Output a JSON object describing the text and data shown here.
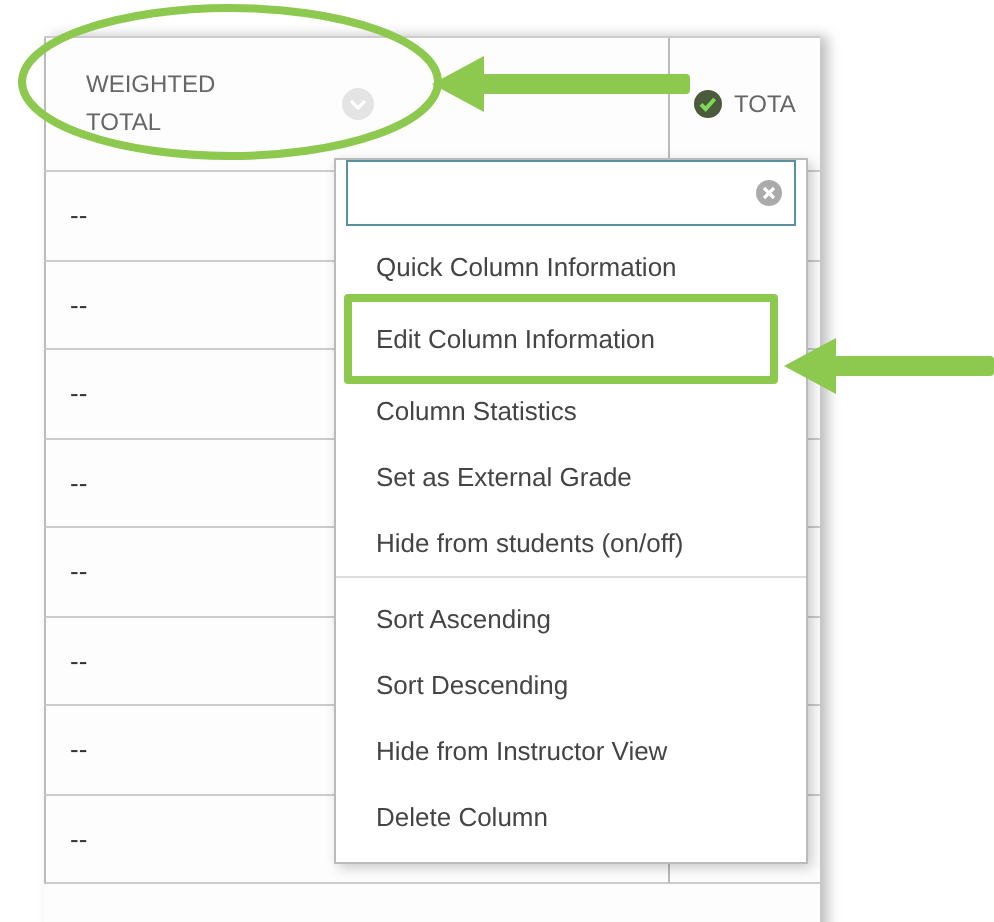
{
  "table": {
    "columns": [
      {
        "label": "WEIGHTED TOTAL",
        "highlighted": true,
        "checked": false
      },
      {
        "label": "TOTA",
        "highlighted": false,
        "checked": true
      }
    ],
    "rows": [
      {
        "cells": [
          "--",
          ""
        ]
      },
      {
        "cells": [
          "--",
          ""
        ]
      },
      {
        "cells": [
          "--",
          ""
        ]
      },
      {
        "cells": [
          "--",
          ""
        ]
      },
      {
        "cells": [
          "--",
          ""
        ]
      },
      {
        "cells": [
          "--",
          ""
        ]
      },
      {
        "cells": [
          "--",
          ""
        ]
      },
      {
        "cells": [
          "--",
          ""
        ]
      }
    ]
  },
  "menu": {
    "groups": [
      [
        {
          "label": "Quick Column Information",
          "highlighted": false
        },
        {
          "label": "Edit Column Information",
          "highlighted": true
        },
        {
          "label": "Column Statistics",
          "highlighted": false
        },
        {
          "label": "Set as External Grade",
          "highlighted": false
        },
        {
          "label": "Hide from students (on/off)",
          "highlighted": false
        }
      ],
      [
        {
          "label": "Sort Ascending",
          "highlighted": false
        },
        {
          "label": "Sort Descending",
          "highlighted": false
        },
        {
          "label": "Hide from Instructor View",
          "highlighted": false
        },
        {
          "label": "Delete Column",
          "highlighted": false
        }
      ]
    ]
  }
}
